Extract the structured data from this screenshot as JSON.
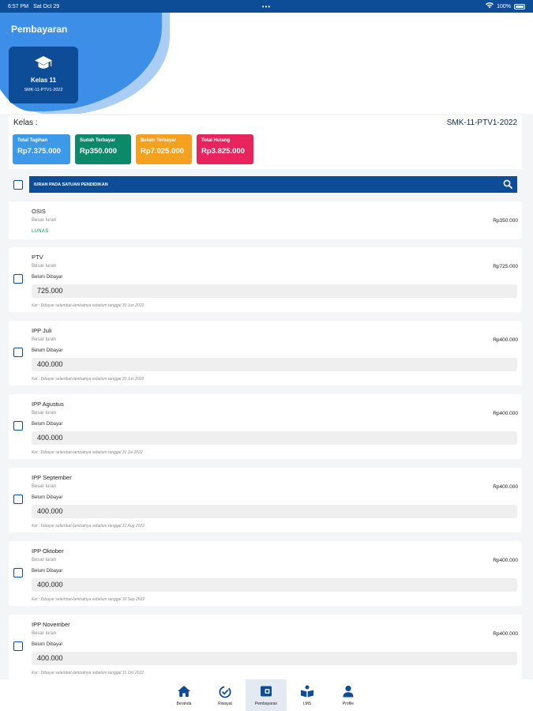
{
  "status_bar": {
    "time": "6:57 PM",
    "date": "Sat Oct 29",
    "dots": "•••",
    "battery": "100%"
  },
  "header": {
    "title": "Pembayaran",
    "class_card": {
      "name": "Kelas 11",
      "code": "SMK-11-PTV1-2022"
    }
  },
  "summary": {
    "label": "Kelas :",
    "class_code": "SMK-11-PTV1-2022",
    "stats": [
      {
        "title": "Total Tagihan",
        "value": "Rp7.375.000",
        "color": "#3d9ae8"
      },
      {
        "title": "Sudah Terbayar",
        "value": "Rp350.000",
        "color": "#0b8a6a"
      },
      {
        "title": "Belum Terbayar",
        "value": "Rp7.025.000",
        "color": "#f3a11f"
      },
      {
        "title": "Total Hutang",
        "value": "Rp3.825.000",
        "color": "#e8235d"
      }
    ]
  },
  "section": {
    "title": "IURAN PADA SATUAN PENDIDIKAN"
  },
  "items": [
    {
      "title": "OSIS",
      "sub": "Besar Iuran",
      "amount": "Rp350.000",
      "status": "LUNAS"
    },
    {
      "title": "PTV",
      "sub": "Besar Iuran",
      "amount": "Rp725.000",
      "status": "Belum Dibayar",
      "value": "725.000",
      "note": "Ket : Dibayar selambat-lambatnya sebelum tanggal 30 Jun 2022"
    },
    {
      "title": "IPP Juli",
      "sub": "Besar Iuran",
      "amount": "Rp400.000",
      "status": "Belum Dibayar",
      "value": "400.000",
      "note": "Ket : Dibayar selambat-lambatnya sebelum tanggal 30 Jun 2022"
    },
    {
      "title": "IPP Agustus",
      "sub": "Besar Iuran",
      "amount": "Rp400.000",
      "status": "Belum Dibayar",
      "value": "400.000",
      "note": "Ket : Dibayar selambat-lambatnya sebelum tanggal 31 Jul 2022"
    },
    {
      "title": "IPP September",
      "sub": "Besar Iuran",
      "amount": "Rp400.000",
      "status": "Belum Dibayar",
      "value": "400.000",
      "note": "Ket : Dibayar selambat-lambatnya sebelum tanggal 31 Aug 2022"
    },
    {
      "title": "IPP Oktober",
      "sub": "Besar Iuran",
      "amount": "Rp400.000",
      "status": "Belum Dibayar",
      "value": "400.000",
      "note": "Ket : Dibayar selambat-lambatnya sebelum tanggal 30 Sep 2022"
    },
    {
      "title": "IPP November",
      "sub": "Besar Iuran",
      "amount": "Rp400.000",
      "status": "Belum Dibayar",
      "value": "400.000",
      "note": "Ket : Dibayar selambat-lambatnya sebelum tanggal 31 Oct 2022"
    }
  ],
  "tabs": [
    {
      "label": "Beranda",
      "icon": "home-icon"
    },
    {
      "label": "Riwayat",
      "icon": "history-icon"
    },
    {
      "label": "Pembayaran",
      "icon": "wallet-icon",
      "active": true
    },
    {
      "label": "LMS",
      "icon": "book-icon"
    },
    {
      "label": "Profile",
      "icon": "user-icon"
    }
  ]
}
